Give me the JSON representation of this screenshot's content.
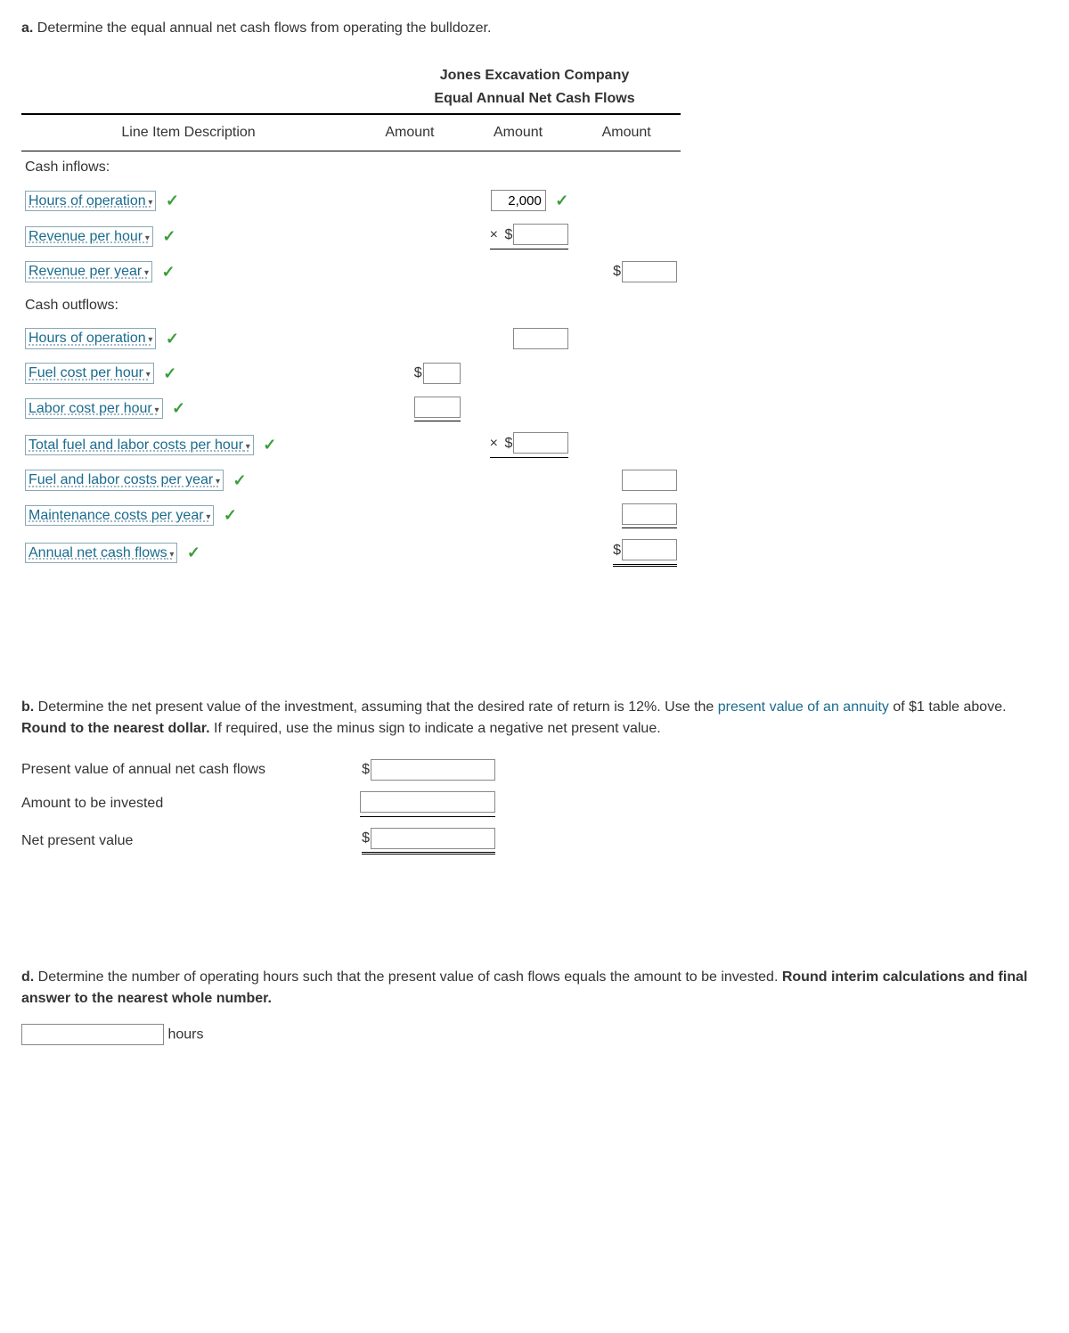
{
  "partA": {
    "label": "a.",
    "prompt": "Determine the equal annual net cash flows from operating the bulldozer.",
    "title1": "Jones Excavation Company",
    "title2": "Equal Annual Net Cash Flows",
    "headers": {
      "desc": "Line Item Description",
      "amt1": "Amount",
      "amt2": "Amount",
      "amt3": "Amount"
    },
    "rows": {
      "inflows_header": "Cash inflows:",
      "hours_in": "Hours of operation",
      "rev_hour": "Revenue per hour",
      "rev_year": "Revenue per year",
      "outflows_header": "Cash outflows:",
      "hours_out": "Hours of operation",
      "fuel_hour": "Fuel cost per hour",
      "labor_hour": "Labor cost per hour",
      "total_fl_hour": "Total fuel and labor costs per hour",
      "fl_year": "Fuel and labor costs per year",
      "maint_year": "Maintenance costs per year",
      "net": "Annual net cash flows"
    },
    "values": {
      "hours_in": "2,000"
    }
  },
  "partB": {
    "label": "b.",
    "text1": "Determine the net present value of the investment, assuming that the desired rate of return is 12%. Use the ",
    "link": "present value of an annuity",
    "text2": " of $1 table above. ",
    "bold": "Round to the nearest dollar.",
    "text3": " If required, use the minus sign to indicate a negative net present value.",
    "rows": {
      "pv": "Present value of annual net cash flows",
      "invest": "Amount to be invested",
      "npv": "Net present value"
    }
  },
  "partD": {
    "label": "d.",
    "text1": "Determine the number of operating hours such that the present value of cash flows equals the amount to be invested. ",
    "bold": "Round interim calculations and final answer to the nearest whole number.",
    "unit": "hours"
  }
}
